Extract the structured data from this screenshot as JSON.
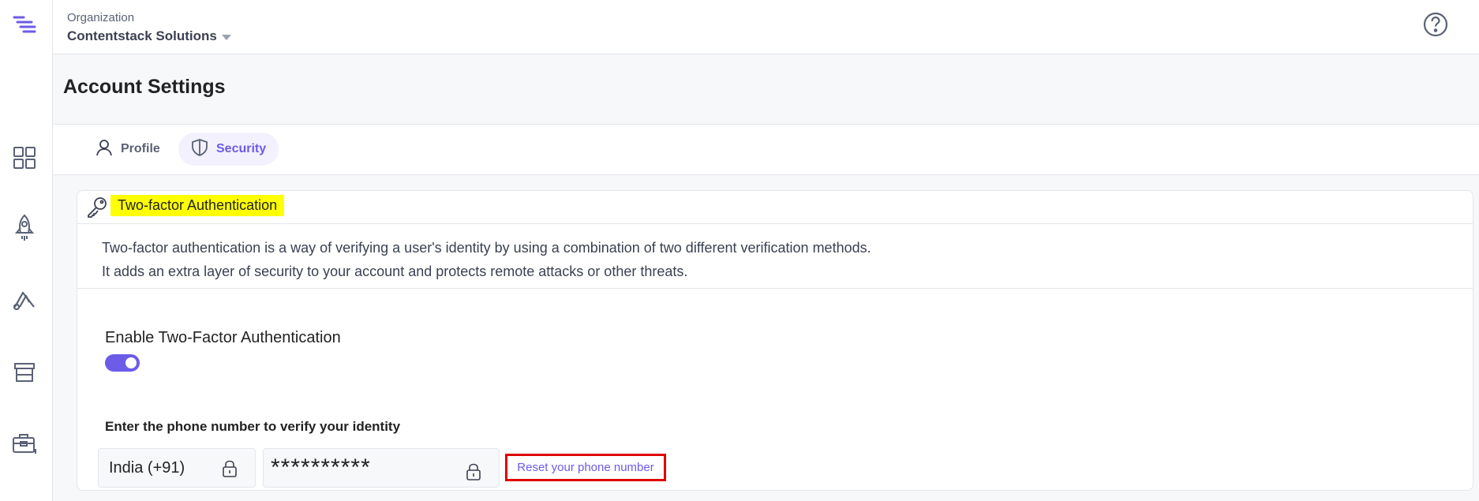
{
  "header": {
    "org_label": "Organization",
    "org_name": "Contentstack Solutions"
  },
  "page": {
    "title": "Account Settings"
  },
  "tabs": [
    {
      "label": "Profile",
      "icon": "user-icon",
      "active": false
    },
    {
      "label": "Security",
      "icon": "shield-icon",
      "active": true
    }
  ],
  "sidebar": {
    "icons": [
      "dashboard-grid-icon",
      "rocket-icon",
      "automate-icon",
      "marketplace-store-icon",
      "toolbox-icon"
    ]
  },
  "two_factor": {
    "title": "Two-factor Authentication",
    "description_line1": "Two-factor authentication is a way of verifying a user's identity by using a combination of two different verification methods.",
    "description_line2": "It adds an extra layer of security to your account and protects remote attacks or other threats.",
    "enable_label": "Enable Two-Factor Authentication",
    "enabled": true,
    "phone_label": "Enter the phone number to verify your identity",
    "country_value": "India (+91)",
    "phone_value": "**********",
    "reset_link": "Reset your phone number"
  },
  "colors": {
    "accent": "#6c5ce7",
    "highlight": "#ffff00",
    "outline_red": "#e00000"
  }
}
